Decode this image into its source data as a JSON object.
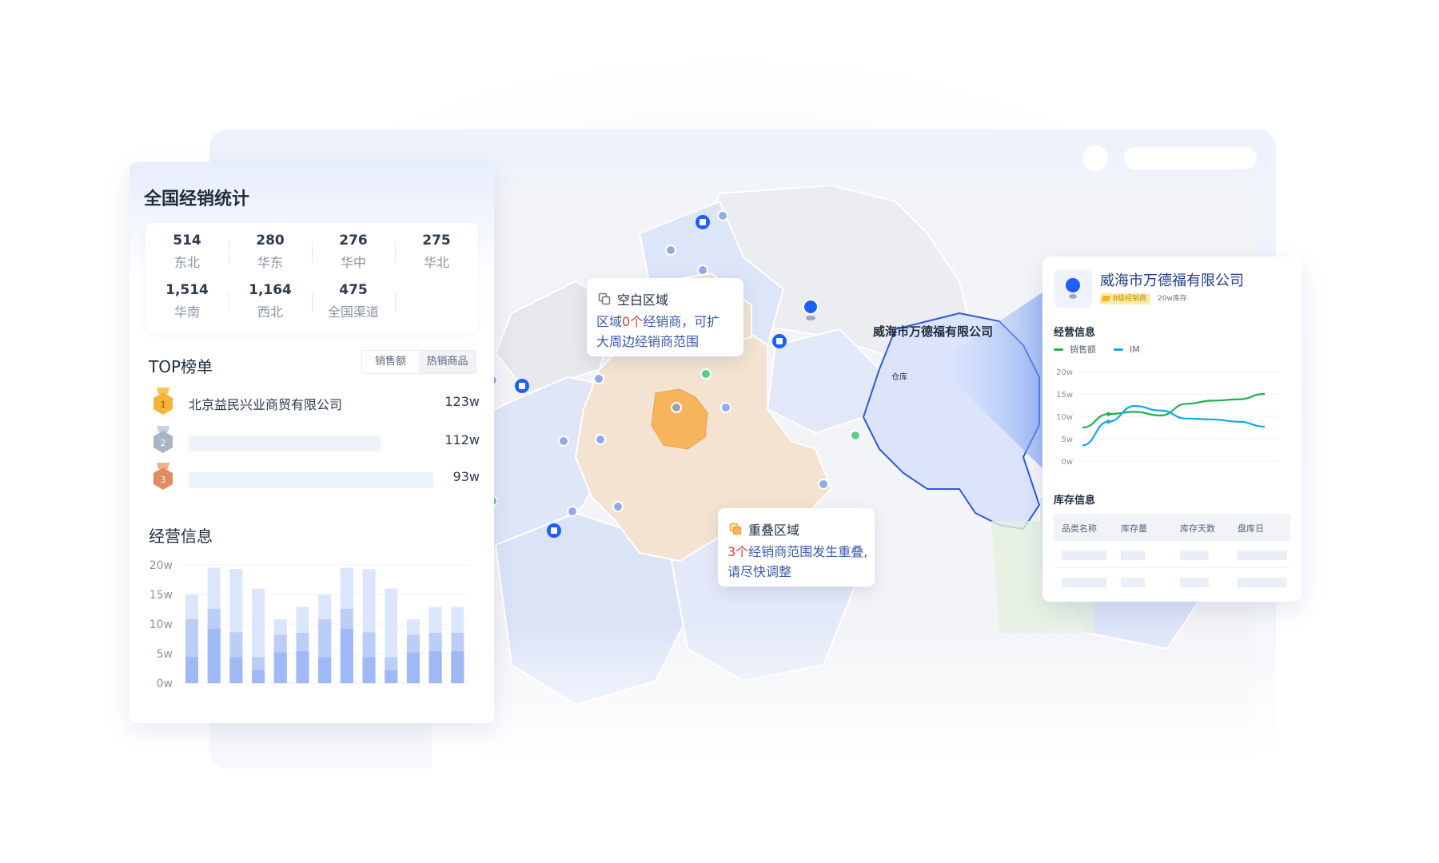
{
  "left_panel": {
    "title": "全国经销统计",
    "stats": [
      {
        "value": "514",
        "label": "东北"
      },
      {
        "value": "280",
        "label": "华东"
      },
      {
        "value": "276",
        "label": "华中"
      },
      {
        "value": "275",
        "label": "华北"
      },
      {
        "value": "1,514",
        "label": "华南"
      },
      {
        "value": "1,164",
        "label": "西北"
      },
      {
        "value": "475",
        "label": "全国渠道"
      }
    ],
    "top_title": "TOP榜单",
    "tabs": [
      "销售额",
      "热销商品"
    ],
    "ranking": [
      {
        "rank": "1",
        "name": "北京益民兴业商贸有限公司",
        "value": "123w",
        "medal_color": "#f2b53a"
      },
      {
        "rank": "2",
        "name": "",
        "value": "112w",
        "medal_color": "#a9b4c8"
      },
      {
        "rank": "3",
        "name": "",
        "value": "93w",
        "medal_color": "#e08c5f"
      }
    ],
    "biz_title": "经营信息",
    "bar_chart": {
      "type": "bar",
      "y_ticks": [
        "20w",
        "15w",
        "10w",
        "5w",
        "0w"
      ],
      "ylim": [
        0,
        20
      ],
      "stack_light": [
        15.0,
        19.5,
        19.3,
        16.0,
        10.8,
        12.9,
        15.0,
        19.5,
        19.3,
        16.0,
        10.8,
        12.9,
        12.9
      ],
      "stack_mid": [
        10.8,
        12.6,
        8.6,
        4.4,
        8.2,
        8.5,
        10.8,
        12.6,
        8.6,
        4.4,
        8.2,
        8.5,
        8.5
      ],
      "stack_dark": [
        4.4,
        9.2,
        4.4,
        2.2,
        5.2,
        5.4,
        4.4,
        9.2,
        4.4,
        2.2,
        5.2,
        5.4,
        5.4
      ]
    }
  },
  "map": {
    "location_label": "威海市万德福有限公司",
    "warehouse_label": "仓库"
  },
  "tooltip_blank": {
    "title": "空白区域",
    "line1_a": "区域",
    "line1_hl": "0个",
    "line1_b": "经销商，可扩",
    "line2": "大周边经销商范围"
  },
  "tooltip_overlap": {
    "title": "重叠区域",
    "line1_hl": "3个",
    "line1_b": "经销商范围发生重叠,",
    "line2": "请尽快调整"
  },
  "right_panel": {
    "company": "威海市万德福有限公司",
    "badge": "B级经销商",
    "stock": "20w库存",
    "biz_title": "经营信息",
    "legend": [
      {
        "name": "销售额",
        "color": "#22b04b"
      },
      {
        "name": "IM",
        "color": "#14a7e8"
      }
    ],
    "chart_data": {
      "type": "line",
      "y_ticks": [
        "20w",
        "15w",
        "10w",
        "5w",
        "0w"
      ],
      "ylim": [
        0,
        20
      ],
      "series": [
        {
          "name": "销售额",
          "values": [
            7.5,
            10.5,
            11.0,
            10.2,
            12.8,
            13.5,
            13.8,
            15.0
          ]
        },
        {
          "name": "IM",
          "values": [
            3.5,
            8.8,
            12.3,
            11.3,
            9.5,
            9.3,
            8.8,
            7.7
          ]
        }
      ]
    },
    "stock_title": "库存信息",
    "table_headers": [
      "品类名称",
      "库存量",
      "库存天数",
      "盘库日"
    ]
  }
}
